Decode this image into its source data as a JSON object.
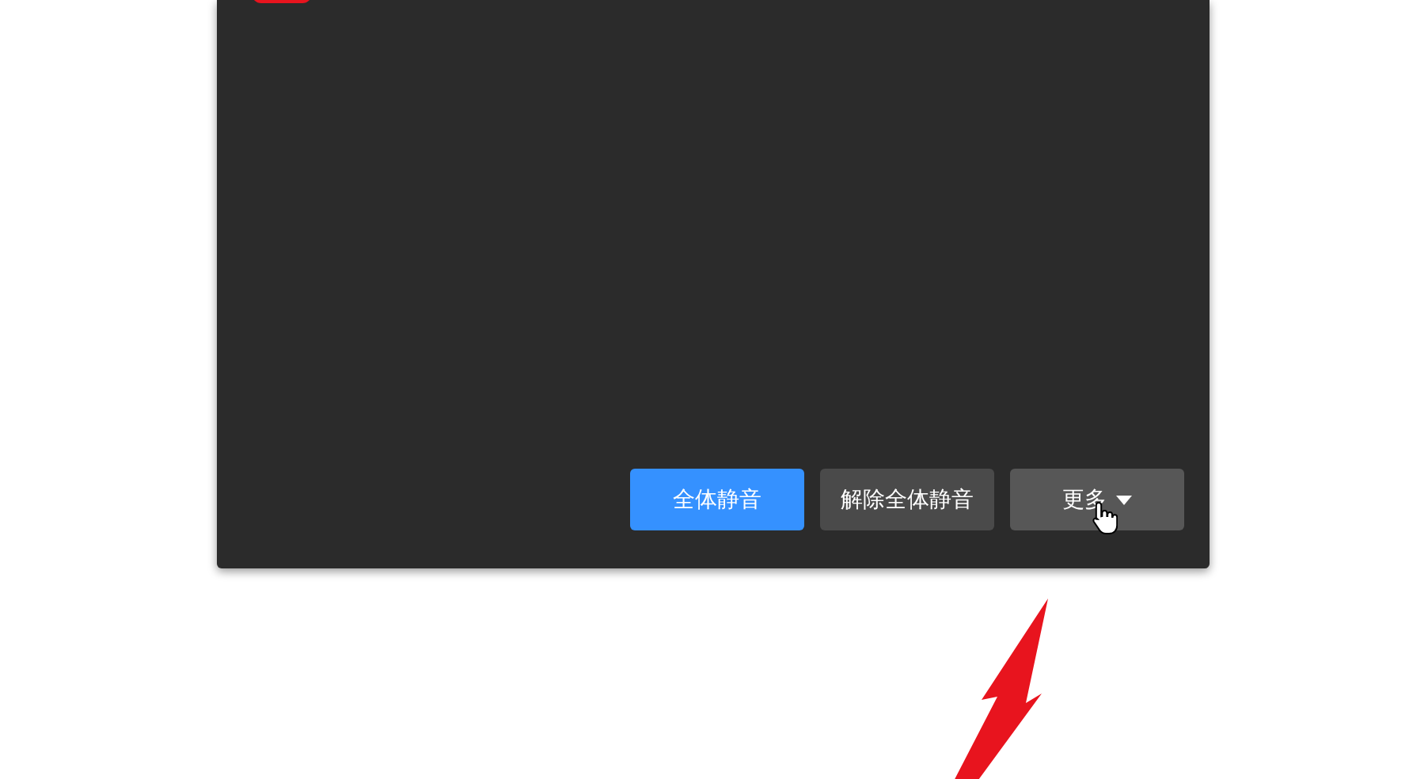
{
  "buttons": [
    {
      "label": "全体静音",
      "kind": "primary"
    },
    {
      "label": "解除全体静音",
      "kind": "secondary"
    },
    {
      "label": "更多",
      "kind": "dropdown"
    }
  ]
}
